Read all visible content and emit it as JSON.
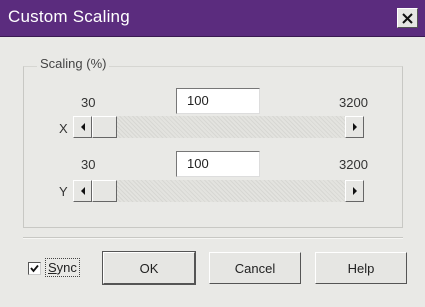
{
  "window": {
    "title": "Custom Scaling"
  },
  "scaling": {
    "group_label": "Scaling (%)",
    "x": {
      "axis_label": "X",
      "min": "30",
      "max": "3200",
      "value": "100"
    },
    "y": {
      "axis_label": "Y",
      "min": "30",
      "max": "3200",
      "value": "100"
    }
  },
  "footer": {
    "sync_label": "Sync",
    "sync_checked": true,
    "ok_label": "OK",
    "cancel_label": "Cancel",
    "help_label": "Help"
  },
  "colors": {
    "titlebar": "#5b2c7e",
    "face": "#e9e9e6"
  }
}
